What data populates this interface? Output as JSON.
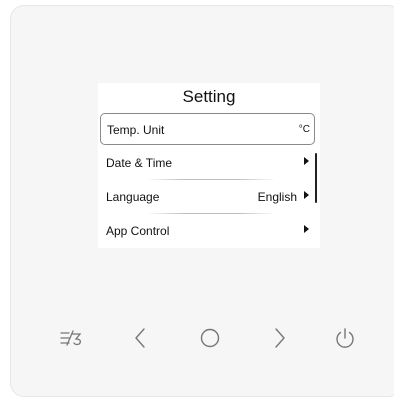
{
  "screen": {
    "title": "Setting",
    "items": [
      {
        "label": "Temp. Unit",
        "value": "",
        "unit": "°C",
        "has_arrow": false,
        "selected": true
      },
      {
        "label": "Date & Time",
        "value": "",
        "unit": "",
        "has_arrow": true,
        "selected": false
      },
      {
        "label": "Language",
        "value": "English",
        "unit": "",
        "has_arrow": true,
        "selected": false
      },
      {
        "label": "App Control",
        "value": "",
        "unit": "",
        "has_arrow": true,
        "selected": false
      }
    ],
    "scroll_position": 0.3
  },
  "buttons": [
    {
      "icon": "fan-speed-icon"
    },
    {
      "icon": "chevron-left-icon"
    },
    {
      "icon": "circle-ok-icon"
    },
    {
      "icon": "chevron-right-icon"
    },
    {
      "icon": "power-icon"
    }
  ],
  "colors": {
    "panel": "#f6f6f6",
    "screen": "#ffffff",
    "text": "#111111",
    "icon": "#777777"
  }
}
